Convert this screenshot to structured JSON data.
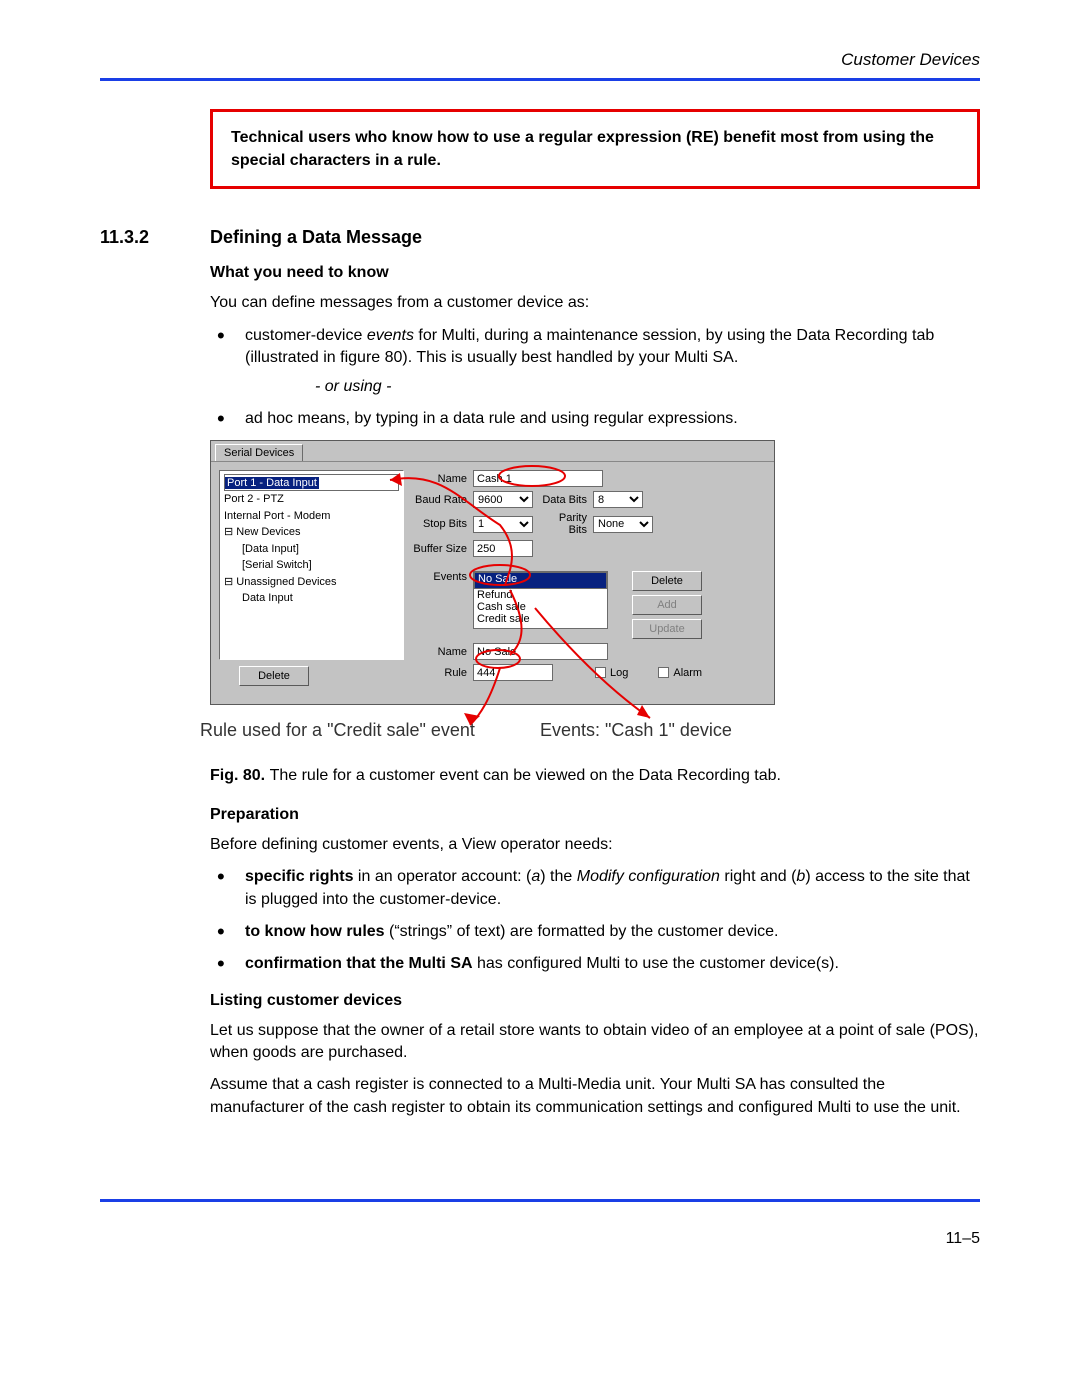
{
  "header": {
    "title": "Customer Devices"
  },
  "note": {
    "text": "Technical users who know how to use a regular expression (RE) benefit most from using the special characters in a rule."
  },
  "section": {
    "number": "11.3.2",
    "title": "Defining a Data Message"
  },
  "sub1": {
    "heading": "What you need to know",
    "intro": "You can define messages from a customer device as:",
    "bullet1_pre": "customer-device ",
    "bullet1_em": "events",
    "bullet1_post": " for Multi, during a maintenance session, by using the Data Recording tab (illustrated in figure 80). This is usually best handled by your Multi SA.",
    "or_using": "- or using -",
    "bullet2": "ad hoc means, by typing in a data rule and using regular expressions."
  },
  "dialog": {
    "tab": "Serial Devices",
    "tree": {
      "port1": "Port 1 - Data Input",
      "port2": "Port 2 - PTZ",
      "internal": "Internal Port - Modem",
      "newdev": "New Devices",
      "datainput": "[Data Input]",
      "serialswitch": "[Serial Switch]",
      "unassigned": "Unassigned Devices",
      "unassigned_child": "Data Input",
      "delete_btn": "Delete"
    },
    "fields": {
      "name_lbl": "Name",
      "name_val": "Cash 1",
      "baud_lbl": "Baud Rate",
      "baud_val": "9600",
      "databits_lbl": "Data Bits",
      "databits_val": "8",
      "stopbits_lbl": "Stop Bits",
      "stopbits_val": "1",
      "parity_lbl": "Parity Bits",
      "parity_val": "None",
      "buffer_lbl": "Buffer Size",
      "buffer_val": "250",
      "events_lbl": "Events",
      "events_opts": {
        "a": "No Sale",
        "b": "Refund",
        "c": "Cash sale",
        "d": "Credit sale"
      },
      "btn_delete": "Delete",
      "btn_add": "Add",
      "btn_update": "Update",
      "name2_lbl": "Name",
      "name2_val": "No Sale",
      "rule_lbl": "Rule",
      "rule_val": "444",
      "log_lbl": "Log",
      "alarm_lbl": "Alarm"
    }
  },
  "callouts": {
    "left": "Rule used for a \"Credit sale\" event",
    "right": "Events: \"Cash 1\" device"
  },
  "figcap": {
    "label": "Fig. 80. ",
    "text": "The rule for a customer event can be viewed on the Data Recording tab."
  },
  "prep": {
    "heading": "Preparation",
    "intro": "Before defining customer events, a View operator needs:",
    "b1_strong": "specific rights",
    "b1_mid1": " in an operator account: (",
    "b1_a": "a",
    "b1_mid2": ") the ",
    "b1_em": "Modify configuration",
    "b1_mid3": " right and (",
    "b1_b": "b",
    "b1_end": ") access to the site that is plugged into the customer-device.",
    "b2_strong": "to know how rules",
    "b2_rest": " (“strings” of text) are formatted by the customer device.",
    "b3_strong": "confirmation that the Multi SA",
    "b3_rest": " has configured Multi to use the customer device(s)."
  },
  "listing": {
    "heading": "Listing customer devices",
    "p1": "Let us suppose that the owner of a retail store wants to obtain video of an employee at a point of sale (POS), when goods are purchased.",
    "p2": "Assume that a cash register is connected to a Multi-Media unit. Your Multi SA has consulted the manufacturer of the cash register to obtain its communication settings and configured Multi to use the unit."
  },
  "footer": {
    "page": "11–5"
  }
}
